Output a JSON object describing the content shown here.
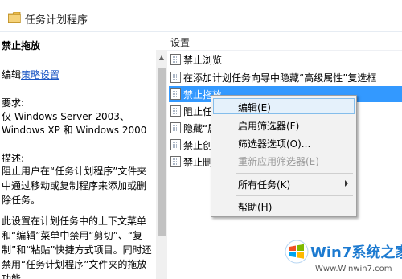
{
  "header": {
    "title": "任务计划程序"
  },
  "left_pane": {
    "title": "禁止拖放",
    "edit_prefix": "编辑",
    "edit_link": "策略设置",
    "requirements_label": "要求:",
    "requirements_line1": "仅 Windows Server 2003、",
    "requirements_line2": "Windows XP 和 Windows 2000",
    "description_label": "描述:",
    "description_p1": "阻止用户在“任务计划程序”文件夹中通过移动或复制程序来添加或删除任务。",
    "description_p2": "此设置在计划任务中的上下文菜单和“编辑”菜单中禁用“剪切”、“复制”和“粘贴”快捷方式项目。同时还禁用“任务计划程序”文件夹的拖放功能"
  },
  "list": {
    "column_header": "设置",
    "rows": [
      {
        "label": "禁止浏览",
        "selected": false
      },
      {
        "label": "在添加计划任务向导中隐藏“高级属性”复选框",
        "selected": false
      },
      {
        "label": "禁止拖放",
        "selected": true
      },
      {
        "label": "阻止任",
        "selected": false
      },
      {
        "label": "隐藏“属",
        "selected": false
      },
      {
        "label": "禁止创",
        "selected": false
      },
      {
        "label": "禁止删",
        "selected": false
      }
    ]
  },
  "context_menu": {
    "items": [
      {
        "label": "编辑(E)",
        "state": "hover"
      },
      {
        "label": "启用筛选器(F)",
        "state": "normal"
      },
      {
        "label": "筛选器选项(O)...",
        "state": "normal"
      },
      {
        "label": "重新应用筛选器(E)",
        "state": "disabled"
      },
      {
        "label": "所有任务(K)",
        "state": "submenu"
      },
      {
        "label": "帮助(H)",
        "state": "normal"
      }
    ]
  },
  "watermark": {
    "brand": "Win7系统之家",
    "url": "Www.Winwin7.com"
  },
  "colors": {
    "selection": "#3399ff",
    "link": "#1a56c4",
    "menu_hover": "#e5f1fb"
  }
}
